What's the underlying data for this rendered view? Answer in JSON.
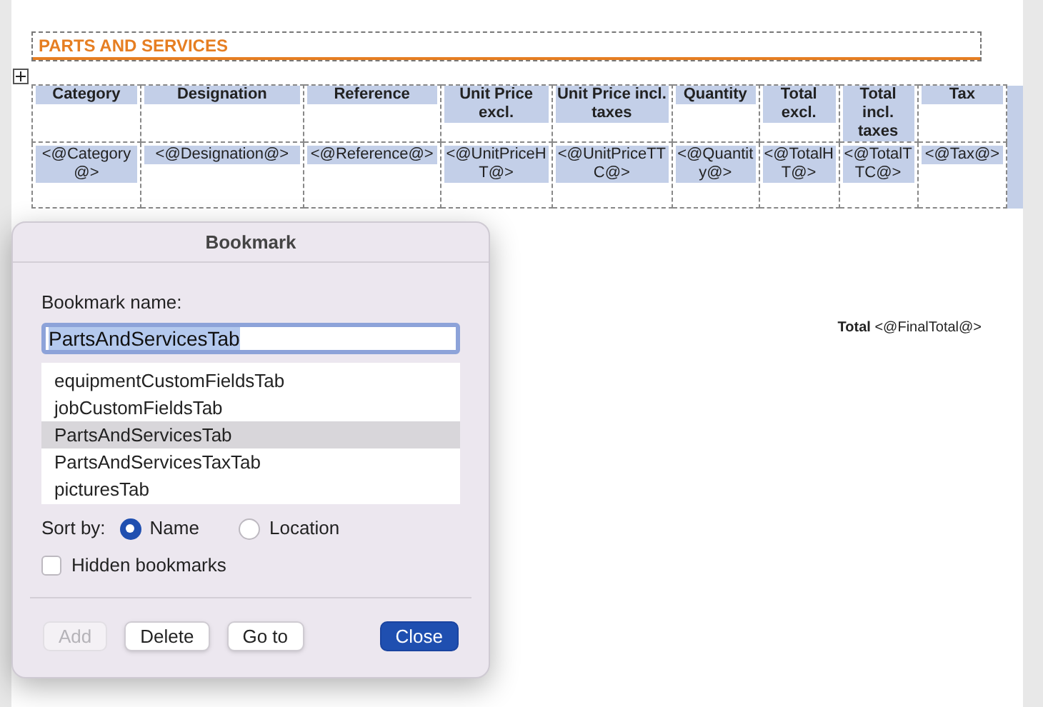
{
  "section_title": "PARTS AND SERVICES",
  "table": {
    "columns": [
      "Category",
      "Designation",
      "Reference",
      "Unit Price excl.",
      "Unit Price incl. taxes",
      "Quantity",
      "Total excl.",
      "Total incl. taxes",
      "Tax"
    ],
    "rows": [
      [
        "<@Category@>",
        "<@Designation@>",
        "<@Reference@>",
        "<@UnitPriceHT@>",
        "<@UnitPriceTTC@>",
        "<@Quantity@>",
        "<@TotalHT@>",
        "<@TotalTTC@>",
        "<@Tax@>"
      ]
    ]
  },
  "total": "**Total** <@FinalTotal@>",
  "dialog": {
    "title": "Bookmark",
    "name_label": "Bookmark name:",
    "name_value": "PartsAndServicesTab",
    "bookmarks": [
      {
        "label": "equipmentCustomFieldsTab",
        "selected": false
      },
      {
        "label": "jobCustomFieldsTab",
        "selected": false
      },
      {
        "label": "PartsAndServicesTab",
        "selected": true
      },
      {
        "label": "PartsAndServicesTaxTab",
        "selected": false
      },
      {
        "label": "picturesTab",
        "selected": false
      }
    ],
    "sort_label": "Sort by:",
    "sort_options": [
      {
        "label": "Name",
        "selected": true
      },
      {
        "label": "Location",
        "selected": false
      }
    ],
    "hidden_bookmarks": {
      "label": "Hidden bookmarks",
      "checked": false
    },
    "buttons": [
      {
        "label": "Add",
        "kind": "secondary",
        "disabled": true
      },
      {
        "label": "Delete",
        "kind": "secondary",
        "disabled": false
      },
      {
        "label": "Go to",
        "kind": "secondary",
        "disabled": false
      },
      {
        "label": "Close",
        "kind": "primary",
        "disabled": false
      }
    ]
  }
}
